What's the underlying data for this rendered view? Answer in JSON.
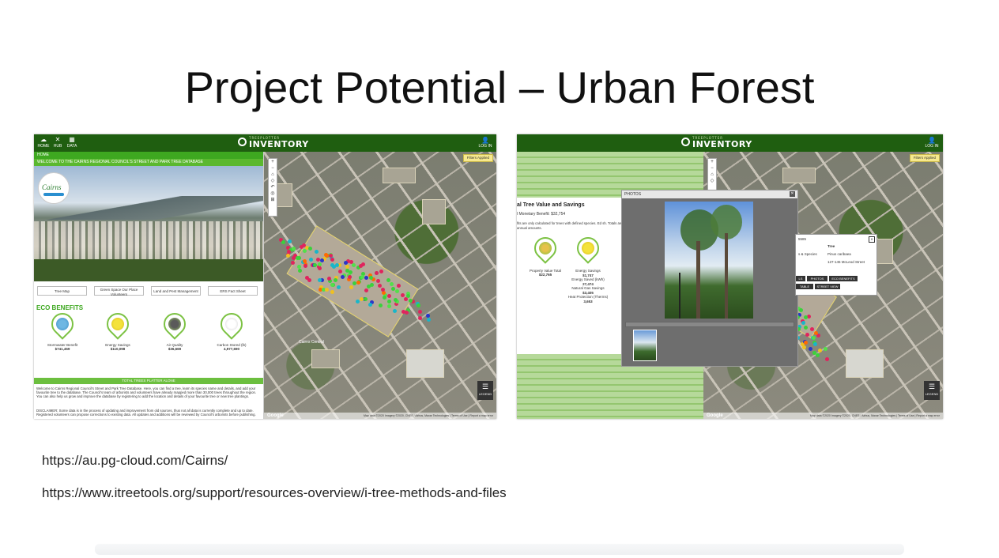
{
  "slide": {
    "title": "Project Potential – Urban Forest",
    "links": [
      "https://au.pg-cloud.com/Cairns/",
      "https://www.itreetools.org/support/resources-overview/i-tree-methods-and-files"
    ]
  },
  "app": {
    "brand_small": "TREEPLOTTER",
    "brand_large": "INVENTORY",
    "nav": [
      {
        "label": "HOME",
        "icon": "cloud-icon"
      },
      {
        "label": "HUB",
        "icon": "tools-icon"
      },
      {
        "label": "DATA",
        "icon": "table-icon"
      }
    ],
    "login_label": "LOG IN",
    "filters_label": "Filters Applied",
    "legend_label": "LEGEND"
  },
  "left_panel": {
    "home_label": "HOME",
    "welcome": "WELCOME TO THE CAIRNS REGIONAL COUNCIL'S STREET AND PARK TREE DATABASE",
    "logo_text": "Cairns",
    "buttons": [
      "Tree Map",
      "Green Space Our Place Volunteers",
      "Land and Pest Management",
      "ERS Fact Sheet"
    ],
    "eco_title": "ECO BENEFITS",
    "eco_items": [
      {
        "label": "Stormwater Benefit",
        "value": "$741,459",
        "icon": "stormwater-icon"
      },
      {
        "label": "Energy Savings",
        "value": "$110,098",
        "icon": "lightbulb-icon"
      },
      {
        "label": "Air Quality",
        "value": "$36,669",
        "icon": "air-quality-icon"
      },
      {
        "label": "Carbon Stored (lb)",
        "value": "4,977,690",
        "icon": "co2-icon"
      }
    ],
    "total_strip": "TOTAL TREES PLATTER ALONE",
    "para1": "Welcome to Cairns Regional Council's Street and Park Tree Database. Here, you can find a tree, learn its species name and details, and add your favourite tree to the database. The Council's team of arborists and volunteers have already mapped more than 30,000 trees throughout the region. You can also help us grow and improve the database by registering to add the location and details of your favourite tree or new tree plantings.",
    "para2": "DISCLAIMER: Some data is in the process of updating and improvement from old sources, thus not all data is currently complete and up to date. Registered volunteers can propose corrections to existing data. All updates and additions will be reviewed by Council's arborists before publishing."
  },
  "right_panel": {
    "heading": "al Tree Value and Savings",
    "monetary": "l Monetary Benefit: $32,754",
    "note": "fits are only calculated for trees with defined species. Ed sh. Totals are annual amounts.",
    "benefits": [
      {
        "label": "Property Value Total",
        "value": "$22,765"
      },
      {
        "label": "Energy Savings",
        "value": "$1,747"
      },
      {
        "label": "Energy Saved (kWh)",
        "value": "27,474"
      },
      {
        "label": "Natural Gas Savings",
        "value": "$3,405"
      },
      {
        "label": "Heat Protection (Therms)",
        "value": "3,653"
      }
    ],
    "photos_title": "PHOTOS",
    "popup": {
      "id": "5585",
      "type_label": "Tree",
      "genus_label": "s & Species",
      "genus_value": "Pinus caribaea",
      "address": "127-145 McLeod Street",
      "buttons": [
        "LS",
        "PHOTOS",
        "ECO BENEFITS",
        "TABLE",
        "STREET VIEW"
      ]
    }
  },
  "map": {
    "zoom_controls": [
      "+",
      "−",
      "⌂",
      "◇",
      "↶",
      "◎",
      "⊞"
    ],
    "attribution": "Map data ©2020 Imagery ©2020, CNES / Airbus, Maxar Technologies | Terms of Use | Report a map error",
    "google": "Google",
    "label": "Cairns Central"
  }
}
